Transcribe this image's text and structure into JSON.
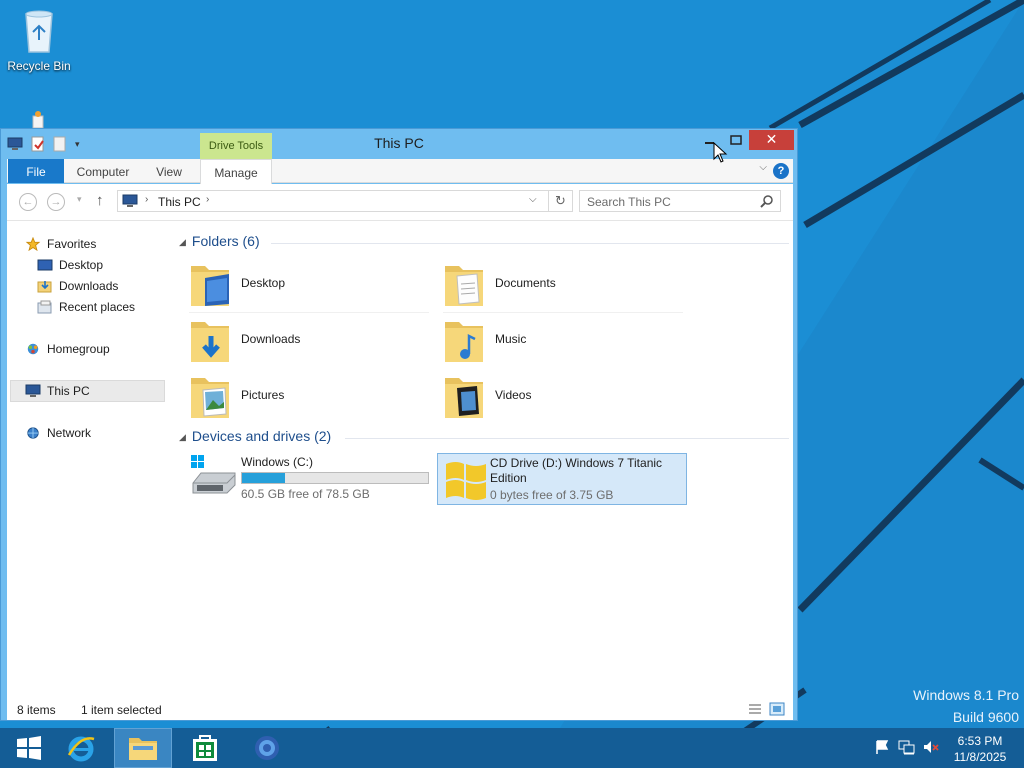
{
  "desktop": {
    "recycle_bin_label": "Recycle Bin",
    "watermark_line1": "Windows 8.1 Pro",
    "watermark_line2": "Build 9600"
  },
  "window": {
    "title": "This PC",
    "context_tab_label": "Drive Tools",
    "close_glyph": "✕"
  },
  "ribbon": {
    "tabs": [
      {
        "label": "File"
      },
      {
        "label": "Computer"
      },
      {
        "label": "View"
      },
      {
        "label": "Manage"
      }
    ],
    "help_glyph": "?"
  },
  "address": {
    "breadcrumb": "This PC",
    "search_placeholder": "Search This PC"
  },
  "nav_pane": {
    "favorites": "Favorites",
    "desktop": "Desktop",
    "downloads": "Downloads",
    "recent_places": "Recent places",
    "homegroup": "Homegroup",
    "this_pc": "This PC",
    "network": "Network"
  },
  "folders": {
    "group_label": "Folders (6)",
    "items": [
      {
        "name": "Desktop"
      },
      {
        "name": "Documents"
      },
      {
        "name": "Downloads"
      },
      {
        "name": "Music"
      },
      {
        "name": "Pictures"
      },
      {
        "name": "Videos"
      }
    ]
  },
  "drives": {
    "group_label": "Devices and drives (2)",
    "items": [
      {
        "name": "Windows (C:)",
        "free_text": "60.5 GB free of 78.5 GB",
        "used_fraction": 0.23
      },
      {
        "name_line1": "CD Drive (D:) Windows 7 Titanic",
        "name_line2": "Edition",
        "free_text": "0 bytes free of 3.75 GB"
      }
    ]
  },
  "status": {
    "item_count": "8 items",
    "selection": "1 item selected"
  },
  "taskbar": {
    "time": "6:53 PM",
    "date": "11/8/2025"
  }
}
